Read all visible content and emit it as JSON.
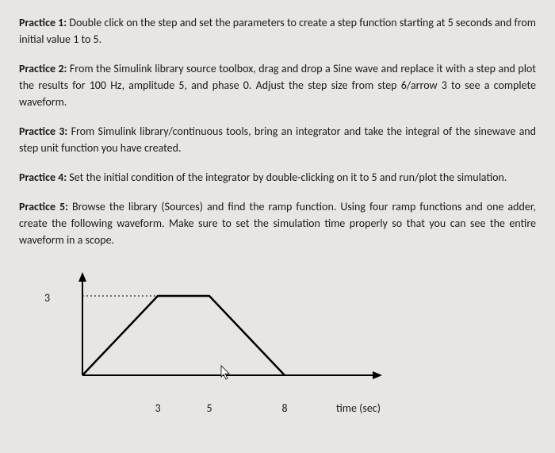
{
  "practices": [
    {
      "label": "Practice 1:",
      "text": " Double click on the step and set the parameters to create a step function starting at 5 seconds and from initial value 1 to 5."
    },
    {
      "label": "Practice 2:",
      "text": " From the Simulink library source toolbox, drag and drop a Sine wave and replace it with a step and plot the results for 100 Hz, amplitude 5, and phase 0. Adjust the step size from step 6/arrow 3 to see a complete waveform."
    },
    {
      "label": "Practice 3:",
      "text": " From Simulink library/continuous tools, bring an integrator and take the integral of the sinewave and step unit function you have created."
    },
    {
      "label": "Practice 4:",
      "text": " Set the initial condition of the integrator by double-clicking on it to 5 and run/plot the simulation."
    },
    {
      "label": "Practice 5:",
      "text": " Browse the library (Sources) and find the ramp function. Using four ramp functions and one adder, create the following waveform. Make sure to set the simulation time properly so that you can see the entire waveform in a scope."
    }
  ],
  "chart_data": {
    "type": "line",
    "x": [
      0,
      3,
      5,
      8
    ],
    "y": [
      0,
      3,
      3,
      0
    ],
    "y_tick": "3",
    "x_ticks": [
      "3",
      "5",
      "8"
    ],
    "xlabel": "time (sec)",
    "ylim": [
      0,
      3.5
    ],
    "xlim": [
      0,
      12
    ]
  }
}
